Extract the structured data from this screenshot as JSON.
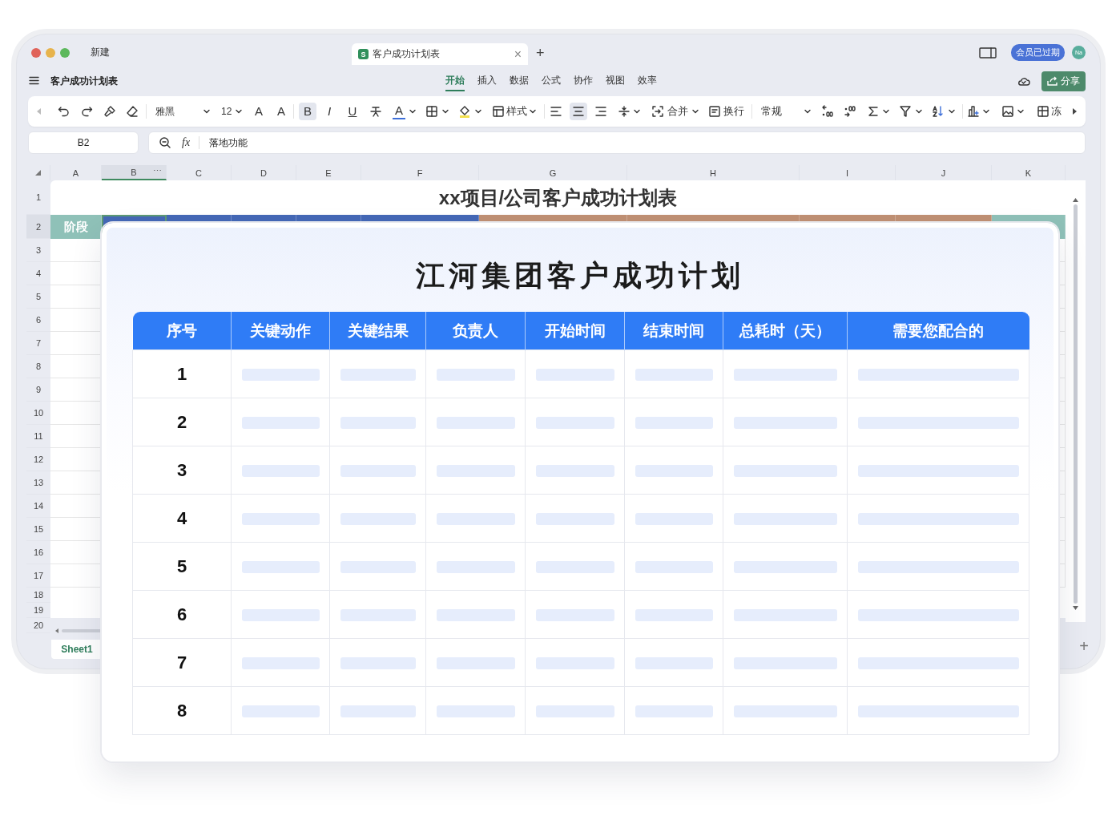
{
  "titlebar": {
    "new_label": "新建",
    "tabs": [
      {
        "icon_label": "S",
        "title": "客户成功计划表",
        "close": "×",
        "selected": true
      }
    ],
    "new_tab": "+",
    "member_badge": "会员已过期",
    "avatar": "Na"
  },
  "menubar": {
    "doc_title": "客户成功计划表",
    "tabs": [
      {
        "label": "开始",
        "selected": true
      },
      {
        "label": "插入",
        "selected": false
      },
      {
        "label": "数据",
        "selected": false
      },
      {
        "label": "公式",
        "selected": false
      },
      {
        "label": "协作",
        "selected": false
      },
      {
        "label": "视图",
        "selected": false
      },
      {
        "label": "效率",
        "selected": false
      }
    ],
    "share": "分享"
  },
  "toolbar": {
    "font": "雅黑",
    "size": "12",
    "grow": "A",
    "shrink": "A",
    "bold": {
      "label": "B",
      "selected": true
    },
    "italic": {
      "label": "I",
      "selected": false
    },
    "underline": {
      "label": "U",
      "selected": false
    },
    "font_color": "A",
    "style": "样式",
    "align": [
      {
        "selected": false
      },
      {
        "selected": true
      },
      {
        "selected": false
      }
    ],
    "merge": "合并",
    "wrap": "换行",
    "number_format": "常规",
    "freeze": "冻"
  },
  "formula_bar": {
    "cell_ref": "B2",
    "fx": "fx",
    "value": "落地功能"
  },
  "sheet": {
    "columns": [
      {
        "label": "A",
        "selected": false
      },
      {
        "label": "B",
        "selected": true,
        "more": "⋯"
      },
      {
        "label": "C",
        "selected": false
      },
      {
        "label": "D",
        "selected": false
      },
      {
        "label": "E",
        "selected": false
      },
      {
        "label": "F",
        "selected": false
      },
      {
        "label": "G",
        "selected": false
      },
      {
        "label": "H",
        "selected": false
      },
      {
        "label": "I",
        "selected": false
      },
      {
        "label": "J",
        "selected": false
      },
      {
        "label": "K",
        "selected": false
      }
    ],
    "rows": [
      {
        "label": "1",
        "selected": false
      },
      {
        "label": "2",
        "selected": true
      },
      {
        "label": "3",
        "selected": false
      },
      {
        "label": "4",
        "selected": false
      },
      {
        "label": "5",
        "selected": false
      },
      {
        "label": "6",
        "selected": false
      },
      {
        "label": "7",
        "selected": false
      },
      {
        "label": "8",
        "selected": false
      },
      {
        "label": "9",
        "selected": false
      },
      {
        "label": "10",
        "selected": false
      },
      {
        "label": "11",
        "selected": false
      },
      {
        "label": "12",
        "selected": false
      },
      {
        "label": "13",
        "selected": false
      },
      {
        "label": "14",
        "selected": false
      },
      {
        "label": "15",
        "selected": false
      },
      {
        "label": "16",
        "selected": false
      },
      {
        "label": "17",
        "selected": false
      },
      {
        "label": "18",
        "selected": false
      },
      {
        "label": "19",
        "selected": false
      },
      {
        "label": "20",
        "selected": false
      }
    ],
    "title": "xx项目/公司客户成功计划表",
    "row2": [
      {
        "text": "阶段",
        "color": "#8fc1b8"
      },
      {
        "color": "#4468b6"
      },
      {
        "color": "#4468b6"
      },
      {
        "color": "#4468b6"
      },
      {
        "color": "#4468b6"
      },
      {
        "color": "#4468b6"
      },
      {
        "color": "#c09073"
      },
      {
        "color": "#c09073"
      },
      {
        "color": "#c09073"
      },
      {
        "color": "#c09073"
      },
      {
        "color": "#8fc1b8"
      }
    ]
  },
  "sheet_tabs": [
    {
      "label": "Sheet1",
      "selected": true
    }
  ],
  "add_sheet": "+",
  "plan": {
    "title": "江河集团客户成功计划",
    "columns": [
      "序号",
      "关键动作",
      "关键结果",
      "负责人",
      "开始时间",
      "结束时间",
      "总耗时（天）",
      "需要您配合的"
    ],
    "rows": [
      {
        "no": "1"
      },
      {
        "no": "2"
      },
      {
        "no": "3"
      },
      {
        "no": "4"
      },
      {
        "no": "5"
      },
      {
        "no": "6"
      },
      {
        "no": "7"
      },
      {
        "no": "8"
      }
    ]
  }
}
